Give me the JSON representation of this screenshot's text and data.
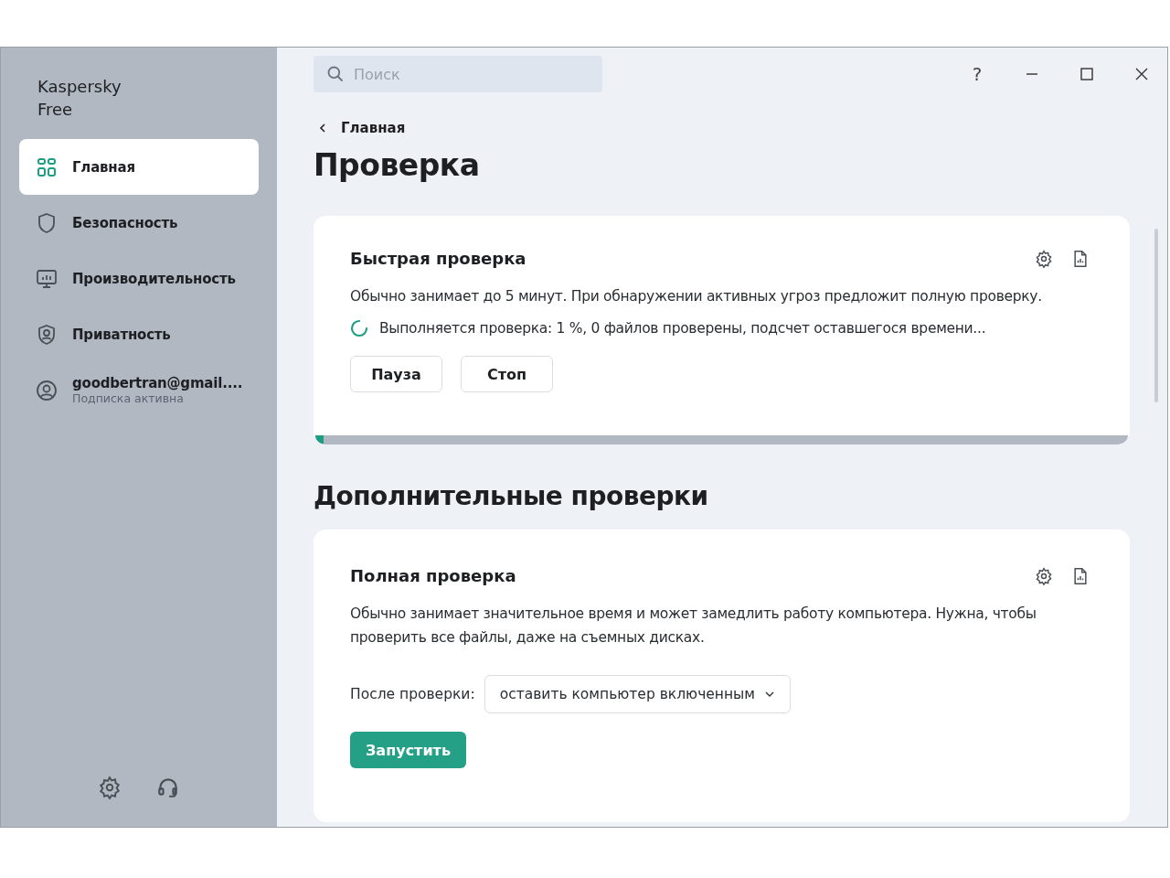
{
  "sidebar": {
    "title": "Kaspersky Free",
    "items": [
      {
        "kind": "home",
        "label": "Главная",
        "selected": true
      },
      {
        "kind": "security",
        "label": "Безопасность",
        "selected": false
      },
      {
        "kind": "performance",
        "label": "Производительность",
        "selected": false
      },
      {
        "kind": "privacy",
        "label": "Приватность",
        "selected": false
      },
      {
        "kind": "account",
        "label": "goodbertran@gmail....",
        "subtitle": "Подписка активна",
        "selected": false
      }
    ]
  },
  "search": {
    "placeholder": "Поиск"
  },
  "window_controls": {
    "help": "?"
  },
  "breadcrumb": "Главная",
  "page_title": "Проверка",
  "quick_scan": {
    "title": "Быстрая проверка",
    "description": "Обычно занимает до 5 минут. При обнаружении активных угроз предложит полную проверку.",
    "status": "Выполняется проверка: 1 %, 0 файлов проверены, подсчет оставшегося времени...",
    "buttons": [
      "Пауза",
      "Стоп"
    ],
    "progress": {
      "level": 0.01
    }
  },
  "section_title": "Дополнительные проверки",
  "full_scan": {
    "title": "Полная проверка",
    "description": "Обычно занимает значительное время и может замедлить работу компьютера. Нужна, чтобы проверить все файлы, даже на съемных дисках.",
    "after_label": "После проверки:",
    "after_value": "оставить компьютер включенным",
    "run_button": "Запустить"
  }
}
